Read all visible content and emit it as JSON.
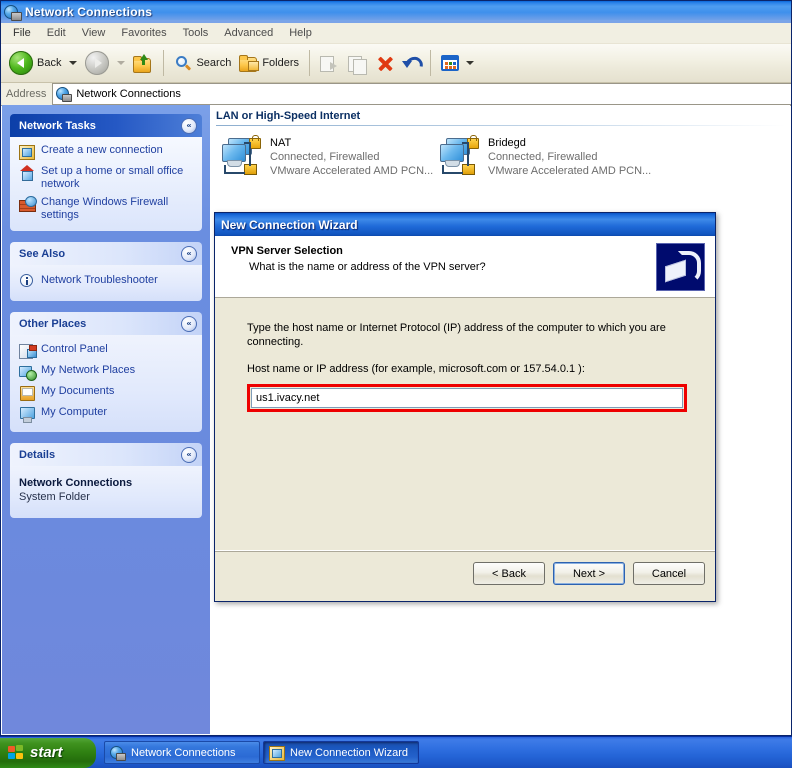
{
  "window": {
    "title": "Network Connections",
    "title_icon": "network-globe-icon"
  },
  "menubar": {
    "items": [
      "File",
      "Edit",
      "View",
      "Favorites",
      "Tools",
      "Advanced",
      "Help"
    ]
  },
  "toolbar": {
    "back_label": "Back",
    "search_label": "Search",
    "folders_label": "Folders",
    "icons": [
      "back-arrow-icon",
      "forward-arrow-icon",
      "up-folder-icon",
      "search-icon",
      "folders-icon",
      "move-to-icon",
      "copy-to-icon",
      "delete-icon",
      "undo-icon",
      "views-icon"
    ]
  },
  "address": {
    "label": "Address",
    "value": "Network Connections",
    "icon": "network-globe-icon"
  },
  "sidebar": {
    "panels": [
      {
        "title": "Network Tasks",
        "style": "blue",
        "items": [
          {
            "label": "Create a new connection",
            "icon": "new-connection-icon"
          },
          {
            "label": "Set up a home or small office network",
            "icon": "home-network-icon"
          },
          {
            "label": "Change Windows Firewall settings",
            "icon": "firewall-icon"
          }
        ]
      },
      {
        "title": "See Also",
        "style": "white",
        "items": [
          {
            "label": "Network Troubleshooter",
            "icon": "info-icon"
          }
        ]
      },
      {
        "title": "Other Places",
        "style": "white",
        "items": [
          {
            "label": "Control Panel",
            "icon": "control-panel-icon"
          },
          {
            "label": "My Network Places",
            "icon": "my-network-places-icon"
          },
          {
            "label": "My Documents",
            "icon": "my-documents-icon"
          },
          {
            "label": "My Computer",
            "icon": "my-computer-icon"
          }
        ]
      },
      {
        "title": "Details",
        "style": "white",
        "detail_title": "Network Connections",
        "detail_sub": "System Folder"
      }
    ],
    "collapse_glyph": "«"
  },
  "content": {
    "group_header": "LAN or High-Speed Internet",
    "connections": [
      {
        "name": "NAT",
        "status": "Connected, Firewalled",
        "device": "VMware Accelerated AMD PCN...",
        "icon": "lan-connection-icon"
      },
      {
        "name": "Bridegd",
        "status": "Connected, Firewalled",
        "device": "VMware Accelerated AMD PCN...",
        "icon": "lan-connection-icon"
      }
    ]
  },
  "dialog": {
    "title": "New Connection Wizard",
    "heading": "VPN Server Selection",
    "subheading": "What is the name or address of the VPN server?",
    "header_icon": "vpn-lock-icon",
    "paragraph": "Type the host name or Internet Protocol (IP) address of the computer to which you are connecting.",
    "field_label": "Host name or IP address (for example, microsoft.com or 157.54.0.1 ):",
    "field_value": "us1.ivacy.net",
    "highlight_color": "#ee0000",
    "buttons": {
      "back": "< Back",
      "next": "Next >",
      "cancel": "Cancel"
    }
  },
  "taskbar": {
    "start_label": "start",
    "items": [
      {
        "label": "Network Connections",
        "icon": "network-globe-icon",
        "state": "normal"
      },
      {
        "label": "New Connection Wizard",
        "icon": "new-connection-icon",
        "state": "active"
      }
    ]
  },
  "colors": {
    "titlebar_blue": "#3f90ec",
    "sidebar_blue": "#6a8ade",
    "panel_header_blue": "#2558c4",
    "dialog_face": "#ece9d8",
    "link_blue": "#1f3fa0",
    "highlight_red": "#ee0000",
    "start_green": "#2f8012"
  }
}
